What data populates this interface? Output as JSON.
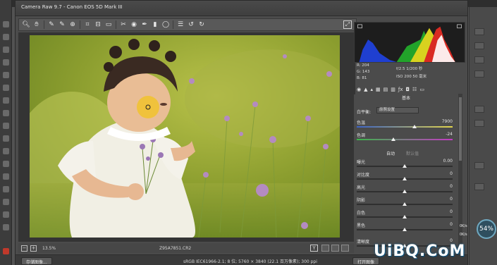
{
  "window": {
    "title": "Camera Raw 9.7 - Canon EOS 5D Mark III"
  },
  "toolbar": {
    "icons": [
      "zoom-icon",
      "hand-icon",
      "white-balance-icon",
      "color-sampler-icon",
      "target-adjust-icon",
      "crop-icon",
      "straighten-icon",
      "transform-icon",
      "spot-removal-icon",
      "red-eye-icon",
      "adjustment-brush-icon",
      "graduated-filter-icon",
      "radial-filter-icon",
      "preferences-icon",
      "rotate-ccw-icon",
      "rotate-cw-icon"
    ]
  },
  "preview": {
    "zoom": "13.5%",
    "filename": "Z95A7851.CR2",
    "y_button": "Y",
    "footer_info": "sRGB IEC61966-2.1; 8 位; 5760 × 3840 (22.1 百万像素); 300 ppi",
    "save_button": "存储图像...",
    "open_button": "打开图像"
  },
  "histogram_meta": {
    "r": "R:  204",
    "g": "G:  143",
    "b": "B:  81",
    "exposure": "f/2.5   1/200 秒",
    "iso": "ISO 200   50 毫米"
  },
  "panel": {
    "section": "基本",
    "wb_label": "白平衡:",
    "wb_value": "原照设置",
    "temp": {
      "label": "色温",
      "value": "7900",
      "level": 0.6
    },
    "tint": {
      "label": "色调",
      "value": "-24",
      "level": 0.38
    },
    "auto": "自动",
    "default": "默认值",
    "exposure": {
      "label": "曝光",
      "value": "0.00",
      "level": 0.5
    },
    "contrast": {
      "label": "对比度",
      "value": "0",
      "level": 0.5
    },
    "highlights": {
      "label": "高光",
      "value": "0",
      "level": 0.5
    },
    "shadows": {
      "label": "阴影",
      "value": "0",
      "level": 0.5
    },
    "whites": {
      "label": "白色",
      "value": "0",
      "level": 0.5
    },
    "blacks": {
      "label": "黑色",
      "value": "0",
      "level": 0.5
    },
    "clarity": {
      "label": "清晰度",
      "value": "0",
      "level": 0.5
    }
  },
  "sidebar_right": {
    "zoom_badge": "54%",
    "speed_up": "0K/s",
    "speed_down": "0K/s"
  },
  "watermark": "UiBQ.CoM",
  "colors": {
    "temp_gradient": [
      "#3b63c7",
      "#e2d44b"
    ],
    "tint_gradient": [
      "#3bb54a",
      "#c43ac4"
    ]
  }
}
